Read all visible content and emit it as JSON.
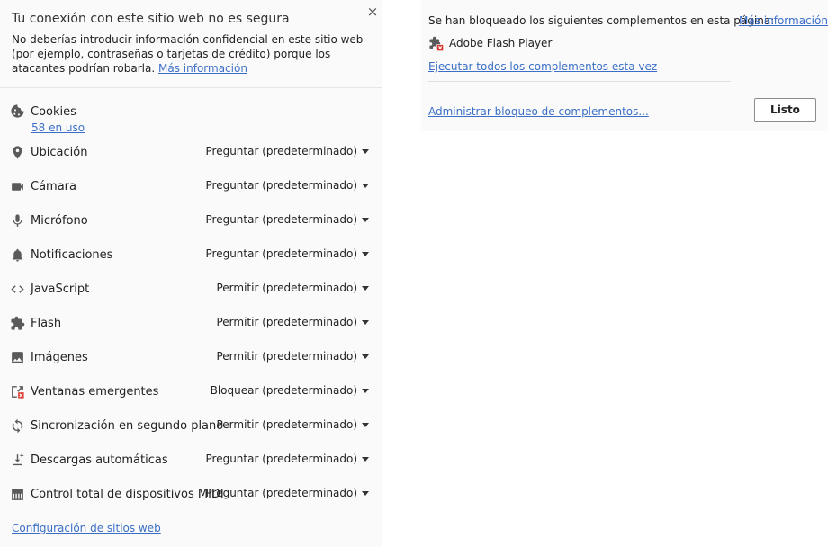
{
  "site_info": {
    "close_glyph": "×",
    "security_title": "Tu conexión con este sitio web no es segura",
    "security_text": "No deberías introducir información confidencial en este sitio web (por ejemplo, contraseñas o tarjetas de crédito) porque los atacantes podrían robarla.",
    "security_more_link": "Más información",
    "cookies": {
      "label": "Cookies",
      "count_link": "58 en uso",
      "icon": "cookie-icon"
    },
    "permissions": [
      {
        "label": "Ubicación",
        "value": "Preguntar (predeterminado)",
        "icon": "location-pin-icon"
      },
      {
        "label": "Cámara",
        "value": "Preguntar (predeterminado)",
        "icon": "camera-icon"
      },
      {
        "label": "Micrófono",
        "value": "Preguntar (predeterminado)",
        "icon": "microphone-icon"
      },
      {
        "label": "Notificaciones",
        "value": "Preguntar (predeterminado)",
        "icon": "bell-icon"
      },
      {
        "label": "JavaScript",
        "value": "Permitir (predeterminado)",
        "icon": "code-brackets-icon"
      },
      {
        "label": "Flash",
        "value": "Permitir (predeterminado)",
        "icon": "puzzle-piece-icon"
      },
      {
        "label": "Imágenes",
        "value": "Permitir (predeterminado)",
        "icon": "image-icon"
      },
      {
        "label": "Ventanas emergentes",
        "value": "Bloquear (predeterminado)",
        "icon": "popup-blocked-icon"
      },
      {
        "label": "Sincronización en segundo plano",
        "value": "Permitir (predeterminado)",
        "icon": "sync-icon"
      },
      {
        "label": "Descargas automáticas",
        "value": "Preguntar (predeterminado)",
        "icon": "download-icon"
      },
      {
        "label": "Control total de dispositivos MIDI",
        "value": "Preguntar (predeterminado)",
        "icon": "piano-keys-icon"
      }
    ],
    "site_settings_link": "Configuración de sitios web"
  },
  "plugins_bubble": {
    "blocked_text": "Se han bloqueado los siguientes complementos en esta página:",
    "more_info_link": "Más información",
    "plugin_name": "Adobe Flash Player",
    "plugin_icon": "plugin-blocked-icon",
    "run_all_link": "Ejecutar todos los complementos esta vez",
    "manage_link": "Administrar bloqueo de complementos...",
    "done_button": "Listo"
  },
  "colors": {
    "link": "#3b6fc7",
    "panel_bg": "#fafafa",
    "icon": "#5a5a5a",
    "blocked_red": "#d93025"
  }
}
